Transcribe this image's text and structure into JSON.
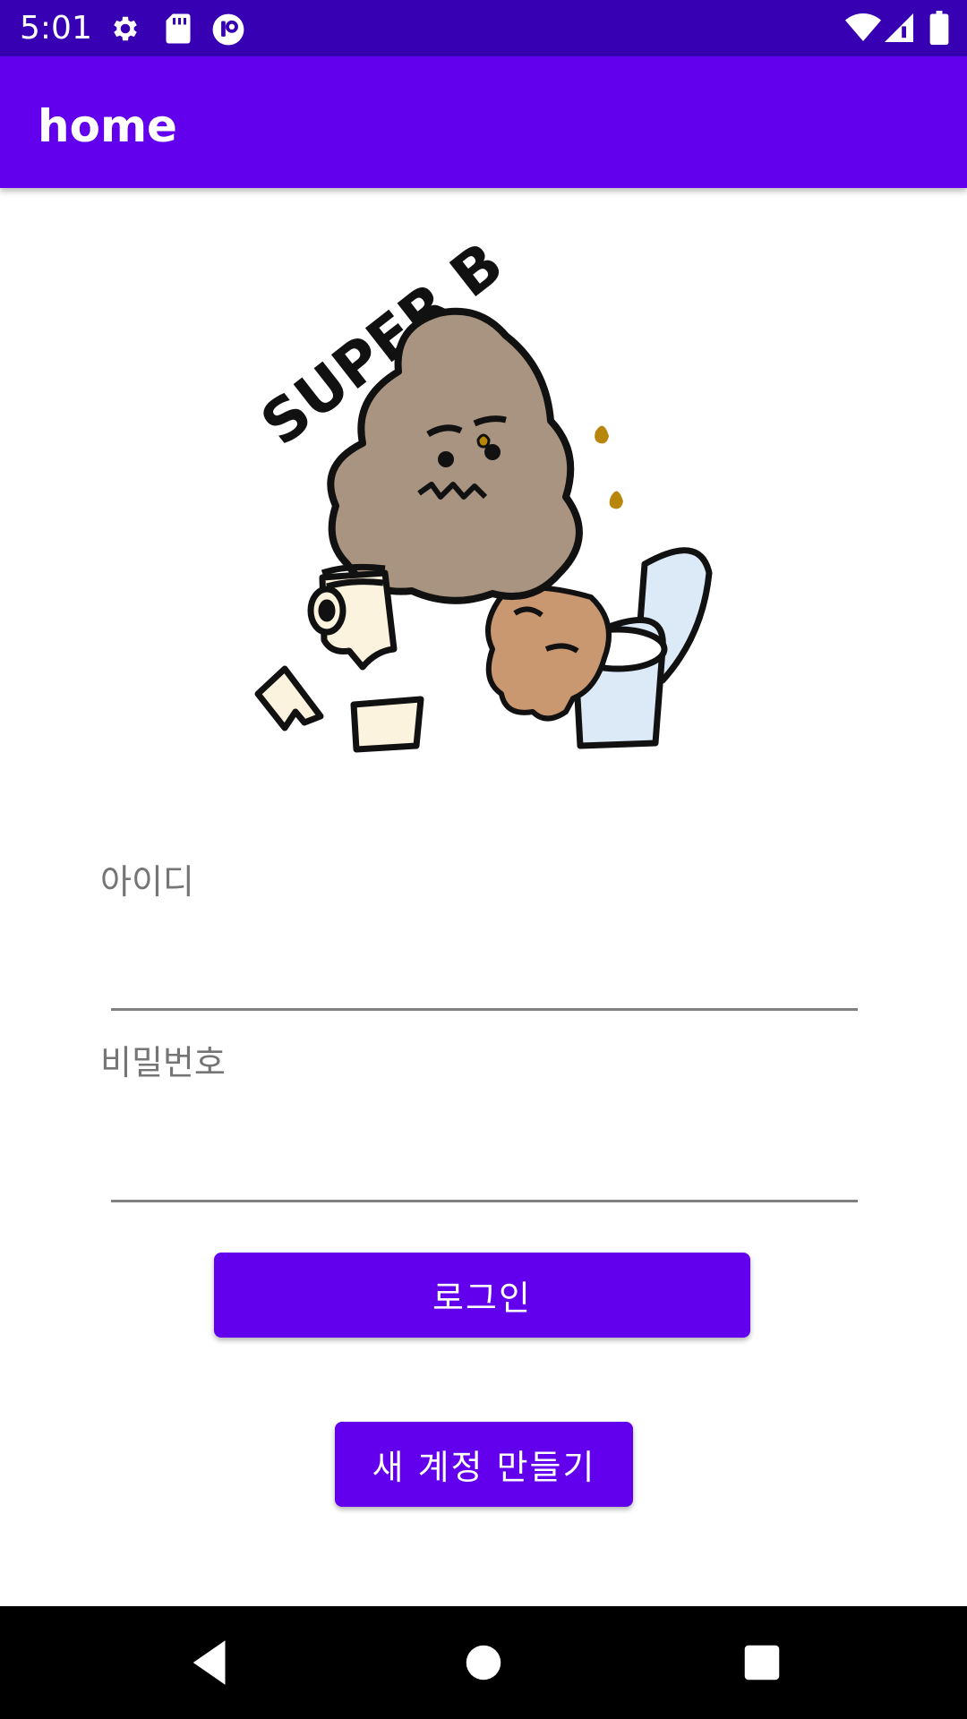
{
  "status_bar": {
    "time": "5:01",
    "left_icons": [
      "gear-icon",
      "sd-card-icon",
      "app-notification-icon"
    ],
    "right_icons": [
      "wifi-icon",
      "cell-signal-icon",
      "battery-icon"
    ]
  },
  "app_bar": {
    "title": "home"
  },
  "illustration": {
    "lettering": "SUPER B"
  },
  "form": {
    "id_label": "아이디",
    "id_value": "",
    "password_label": "비밀번호",
    "password_value": ""
  },
  "buttons": {
    "login": "로그인",
    "create_account": "새 계정 만들기"
  },
  "nav_bar": {
    "icons": [
      "back-icon",
      "home-icon",
      "recents-icon"
    ]
  },
  "colors": {
    "primary": "#6200EE",
    "primary_dark": "#3700B3",
    "on_primary": "#FFFFFF",
    "underline": "#808080",
    "label": "#757575"
  }
}
